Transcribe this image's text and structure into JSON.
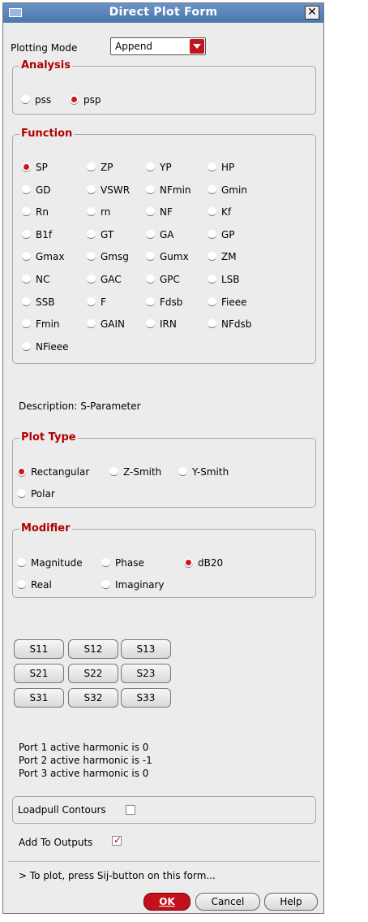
{
  "window": {
    "title": "Direct Plot Form",
    "close_glyph": "✕"
  },
  "plotting_mode": {
    "label": "Plotting Mode",
    "value": "Append"
  },
  "analysis": {
    "label": "Analysis",
    "options": [
      {
        "label": "pss",
        "selected": false
      },
      {
        "label": "psp",
        "selected": true
      }
    ]
  },
  "function": {
    "label": "Function",
    "options": [
      {
        "label": "SP",
        "selected": true
      },
      {
        "label": "ZP",
        "selected": false
      },
      {
        "label": "YP",
        "selected": false
      },
      {
        "label": "HP",
        "selected": false
      },
      {
        "label": "GD",
        "selected": false
      },
      {
        "label": "VSWR",
        "selected": false
      },
      {
        "label": "NFmin",
        "selected": false
      },
      {
        "label": "Gmin",
        "selected": false
      },
      {
        "label": "Rn",
        "selected": false
      },
      {
        "label": "rn",
        "selected": false
      },
      {
        "label": "NF",
        "selected": false
      },
      {
        "label": "Kf",
        "selected": false
      },
      {
        "label": "B1f",
        "selected": false
      },
      {
        "label": "GT",
        "selected": false
      },
      {
        "label": "GA",
        "selected": false
      },
      {
        "label": "GP",
        "selected": false
      },
      {
        "label": "Gmax",
        "selected": false
      },
      {
        "label": "Gmsg",
        "selected": false
      },
      {
        "label": "Gumx",
        "selected": false
      },
      {
        "label": "ZM",
        "selected": false
      },
      {
        "label": "NC",
        "selected": false
      },
      {
        "label": "GAC",
        "selected": false
      },
      {
        "label": "GPC",
        "selected": false
      },
      {
        "label": "LSB",
        "selected": false
      },
      {
        "label": "SSB",
        "selected": false
      },
      {
        "label": "F",
        "selected": false
      },
      {
        "label": "Fdsb",
        "selected": false
      },
      {
        "label": "Fieee",
        "selected": false
      },
      {
        "label": "Fmin",
        "selected": false
      },
      {
        "label": "GAIN",
        "selected": false
      },
      {
        "label": "IRN",
        "selected": false
      },
      {
        "label": "NFdsb",
        "selected": false
      },
      {
        "label": "NFieee",
        "selected": false
      }
    ]
  },
  "description": "Description: S-Parameter",
  "plot_type": {
    "label": "Plot Type",
    "options": [
      {
        "label": "Rectangular",
        "selected": true
      },
      {
        "label": "Z-Smith",
        "selected": false
      },
      {
        "label": "Y-Smith",
        "selected": false
      },
      {
        "label": "Polar",
        "selected": false
      }
    ]
  },
  "modifier": {
    "label": "Modifier",
    "options": [
      {
        "label": "Magnitude",
        "selected": false
      },
      {
        "label": "Phase",
        "selected": false
      },
      {
        "label": "dB20",
        "selected": true
      },
      {
        "label": "Real",
        "selected": false
      },
      {
        "label": "Imaginary",
        "selected": false
      }
    ]
  },
  "sij_buttons": [
    "S11",
    "S12",
    "S13",
    "S21",
    "S22",
    "S23",
    "S31",
    "S32",
    "S33"
  ],
  "harmonics": [
    "Port 1 active harmonic is 0",
    "Port 2 active harmonic is -1",
    "Port 3 active harmonic is 0"
  ],
  "loadpull": {
    "label": "Loadpull Contours",
    "checked": false
  },
  "add_outputs": {
    "label": "Add To Outputs",
    "checked": true,
    "check_glyph": "✓"
  },
  "hint": "> To plot, press Sij-button on this form...",
  "buttons": {
    "ok": {
      "label": "OK"
    },
    "cancel": {
      "label": "Cancel"
    },
    "help": {
      "label": "Help"
    }
  }
}
